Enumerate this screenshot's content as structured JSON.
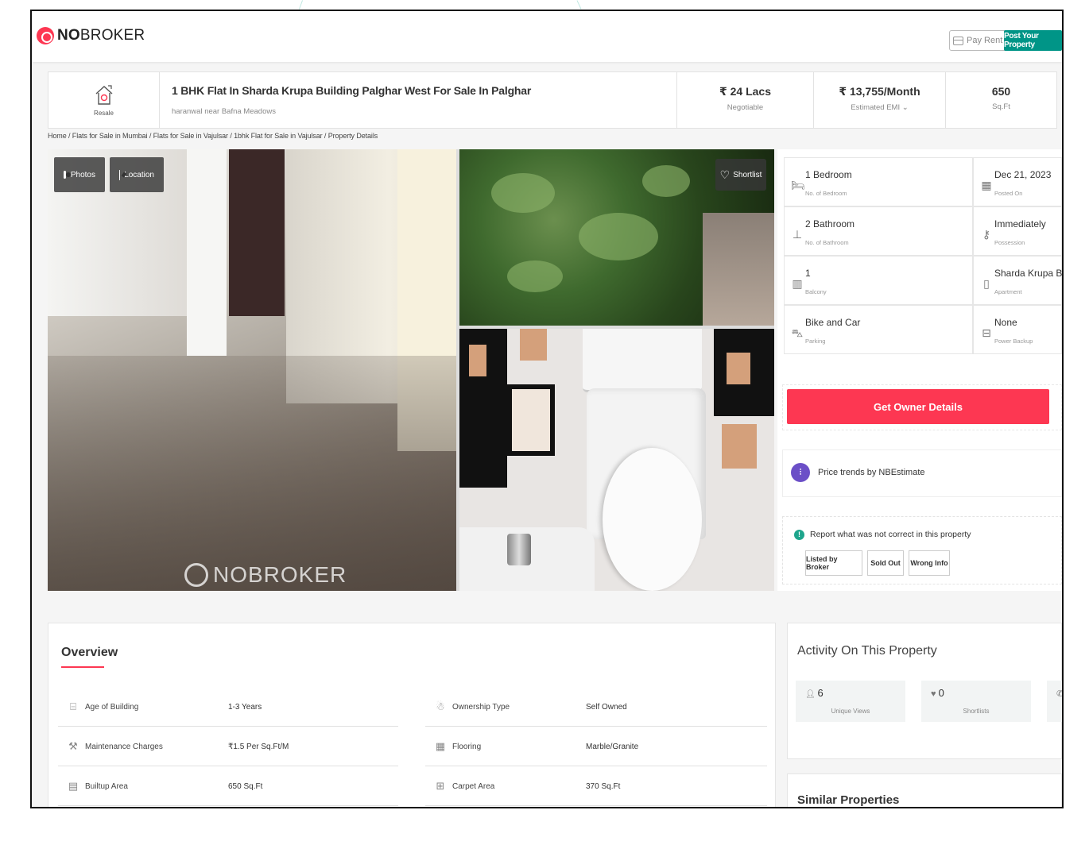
{
  "header": {
    "logo_bold": "NO",
    "logo_rest": "BROKER",
    "pay_rent": "Pay Rent",
    "post_property": "Post Your Property",
    "brand_color": "#fd3752",
    "accent_color": "#009587"
  },
  "listing": {
    "type_label": "Resale",
    "title": "1 BHK Flat In Sharda Krupa Building Palghar West For Sale In Palghar",
    "subtitle": "haranwal near Bafna Meadows",
    "price": {
      "value": "₹ 24 Lacs",
      "label": "Negotiable"
    },
    "emi": {
      "value": "₹ 13,755/Month",
      "label": "Estimated EMI ⌄"
    },
    "area": {
      "value": "650",
      "label": "Sq.Ft"
    }
  },
  "breadcrumb": "Home / Flats for Sale in Mumbai / Flats for Sale in Vajulsar / 1bhk Flat for Sale in Vajulsar / Property Details",
  "gallery": {
    "photos": "Photos",
    "location": "Location",
    "shortlist": "Shortlist",
    "watermark": "NOBROKER"
  },
  "details": [
    {
      "icon": "bed-icon",
      "value": "1 Bedroom",
      "label": "No. of Bedroom"
    },
    {
      "icon": "calendar-icon",
      "value": "Dec 21, 2023",
      "label": "Posted On"
    },
    {
      "icon": "bath-icon",
      "value": "2 Bathroom",
      "label": "No. of Bathroom"
    },
    {
      "icon": "key-icon",
      "value": "Immediately",
      "label": "Possession"
    },
    {
      "icon": "balcony-icon",
      "value": "1",
      "label": "Balcony"
    },
    {
      "icon": "building-icon",
      "value": "Sharda Krupa Build...",
      "label": "Apartment"
    },
    {
      "icon": "car-icon",
      "value": "Bike and Car",
      "label": "Parking"
    },
    {
      "icon": "battery-icon",
      "value": "None",
      "label": "Power Backup"
    }
  ],
  "actions": {
    "get_owner": "Get Owner Details",
    "price_trends": "Price trends by NBEstimate",
    "report_text": "Report what was not correct in this property",
    "report_buttons": [
      "Listed by Broker",
      "Sold Out",
      "Wrong Info"
    ]
  },
  "overview": {
    "title": "Overview",
    "rows": [
      {
        "icon": "building-age-icon",
        "label": "Age of Building",
        "value": "1-3 Years"
      },
      {
        "icon": "owner-icon",
        "label": "Ownership Type",
        "value": "Self Owned"
      },
      {
        "icon": "tools-icon",
        "label": "Maintenance Charges",
        "value": "₹1.5 Per Sq.Ft/M"
      },
      {
        "icon": "flooring-icon",
        "label": "Flooring",
        "value": "Marble/Granite"
      },
      {
        "icon": "builtup-icon",
        "label": "Builtup Area",
        "value": "650 Sq.Ft"
      },
      {
        "icon": "carpet-icon",
        "label": "Carpet Area",
        "value": "370 Sq.Ft"
      }
    ]
  },
  "activity": {
    "title": "Activity On This Property",
    "stats": [
      {
        "icon": "user-icon",
        "value": "6",
        "label": "Unique Views"
      },
      {
        "icon": "heart-icon",
        "value": "0",
        "label": "Shortlists"
      },
      {
        "icon": "phone-icon",
        "value": "",
        "label": ""
      }
    ]
  },
  "similar": {
    "title": "Similar Properties"
  }
}
